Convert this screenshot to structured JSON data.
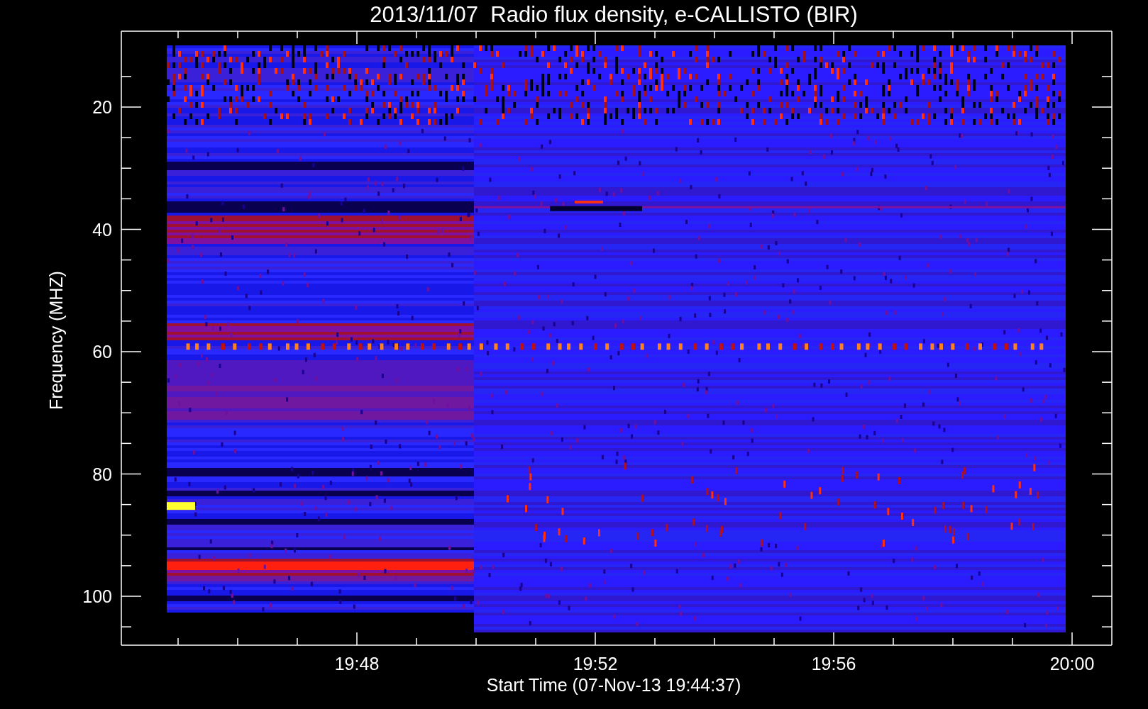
{
  "title": "2013/11/07  Radio flux density, e-CALLISTO (BIR)",
  "y_axis": {
    "label": "Frequency (MHZ)",
    "tick_labels": [
      "20",
      "40",
      "60",
      "80",
      "100"
    ]
  },
  "x_axis": {
    "label": "Start Time (07-Nov-13 19:44:37)",
    "tick_labels": [
      "19:48",
      "19:52",
      "19:56",
      "20:00"
    ]
  }
}
